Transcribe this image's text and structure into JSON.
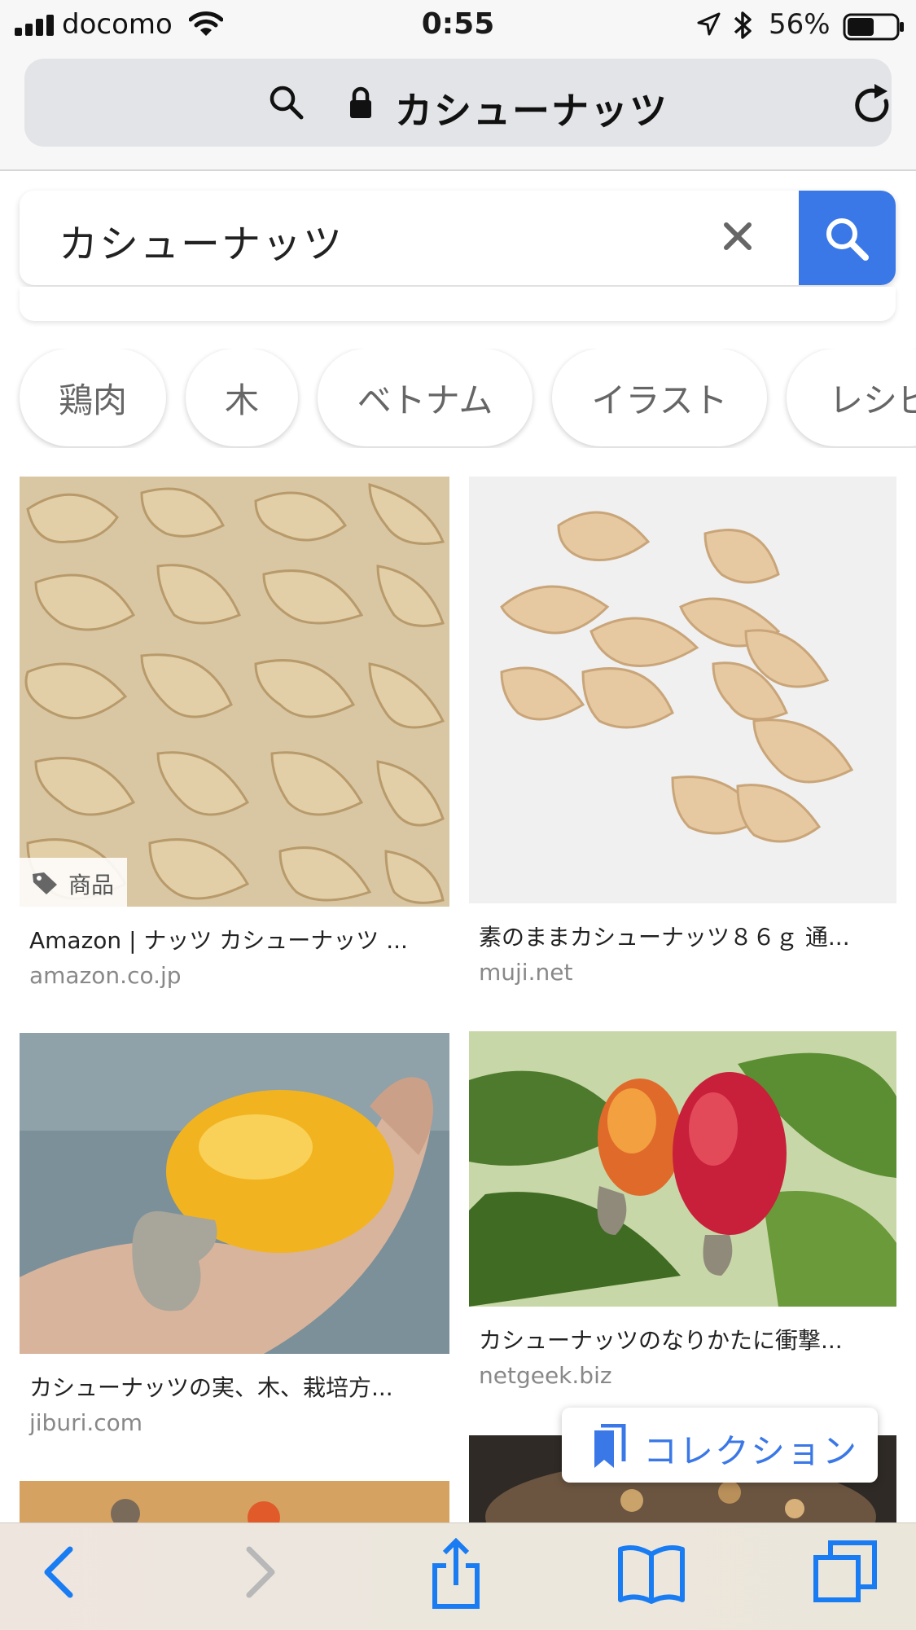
{
  "status_bar": {
    "carrier": "docomo",
    "time": "0:55",
    "battery_percent": "56%",
    "battery_level": 0.56,
    "icons": [
      "signal-icon",
      "wifi-icon",
      "location-arrow-icon",
      "bluetooth-icon",
      "battery-icon"
    ]
  },
  "url_bar": {
    "text": "カシューナッツ",
    "icons": [
      "search-icon",
      "lock-icon",
      "reload-icon"
    ]
  },
  "search": {
    "query": "カシューナッツ",
    "accent_color": "#3b78e7",
    "icons": [
      "clear-icon",
      "search-icon"
    ]
  },
  "chips": [
    {
      "label": "鶏肉"
    },
    {
      "label": "木"
    },
    {
      "label": "ベトナム"
    },
    {
      "label": "イラスト"
    },
    {
      "label": "レシピ"
    }
  ],
  "results": [
    {
      "title": "Amazon | ナッツ カシューナッツ ...",
      "domain": "amazon.co.jp",
      "badge": "商品",
      "image": "raw-cashews-pile"
    },
    {
      "title": "素のままカシューナッツ８６ｇ 通...",
      "domain": "muji.net",
      "image": "cashews-on-white"
    },
    {
      "title": "カシューナッツの実、木、栽培方...",
      "domain": "jiburi.com",
      "image": "cashew-apple-in-hand"
    },
    {
      "title": "カシューナッツのなりかたに衝撃...",
      "domain": "netgeek.biz",
      "image": "cashew-apples-on-tree"
    }
  ],
  "collection_button": {
    "label": "コレクション"
  },
  "toolbar": {
    "icons": [
      "back-icon",
      "forward-icon",
      "share-icon",
      "bookmarks-icon",
      "tabs-icon"
    ]
  }
}
